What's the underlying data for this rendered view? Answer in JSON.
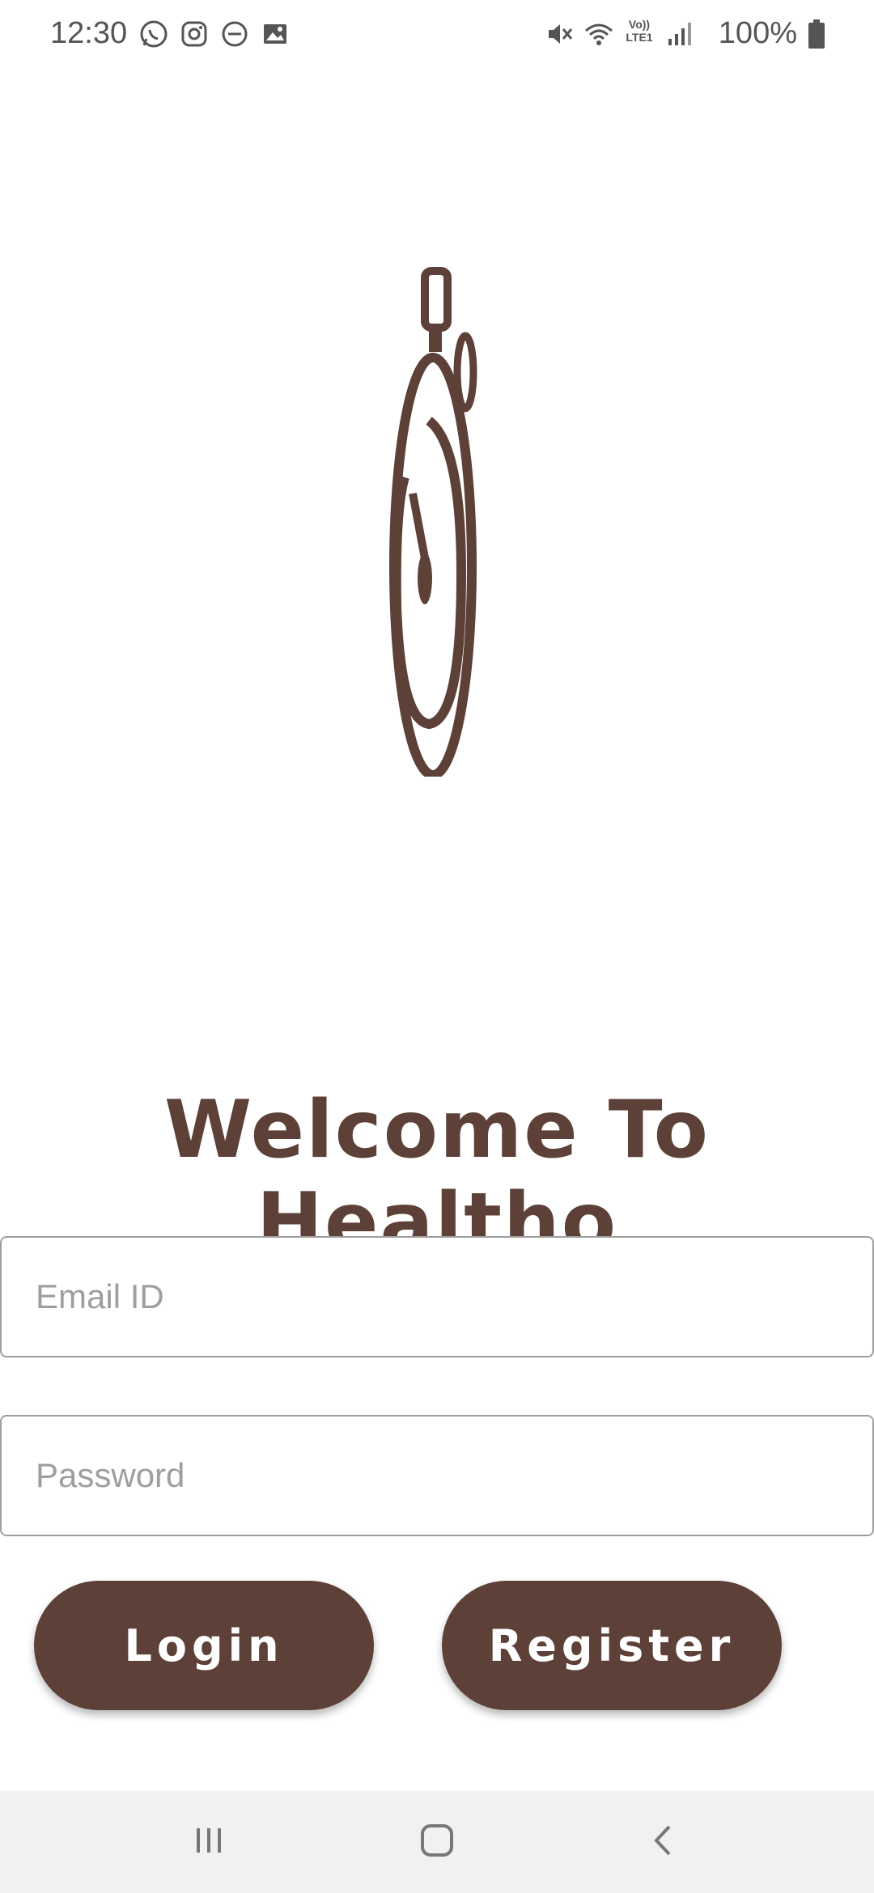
{
  "status_bar": {
    "time": "12:30",
    "left_icons": [
      "whatsapp-icon",
      "instagram-icon",
      "do-not-disturb-icon",
      "gallery-icon"
    ],
    "right_icons": [
      "mute-icon",
      "wifi-icon",
      "volte-lte-icon",
      "signal-icon"
    ],
    "battery": "100%",
    "volte_label_top": "Vo))",
    "volte_label_bottom": "LTE1"
  },
  "logo": {
    "icon": "stopwatch-icon",
    "color": "#5d4037"
  },
  "welcome": {
    "title": "Welcome To Healtho"
  },
  "form": {
    "email_placeholder": "Email ID",
    "email_value": "",
    "password_placeholder": "Password",
    "password_value": ""
  },
  "buttons": {
    "login": "Login",
    "register": "Register"
  },
  "nav_bar": {
    "items": [
      "recents-icon",
      "home-icon",
      "back-icon"
    ]
  },
  "colors": {
    "brand": "#5d4037",
    "background": "#ffffff",
    "nav_background": "#f1f1f1",
    "placeholder": "#9e9e9e"
  }
}
